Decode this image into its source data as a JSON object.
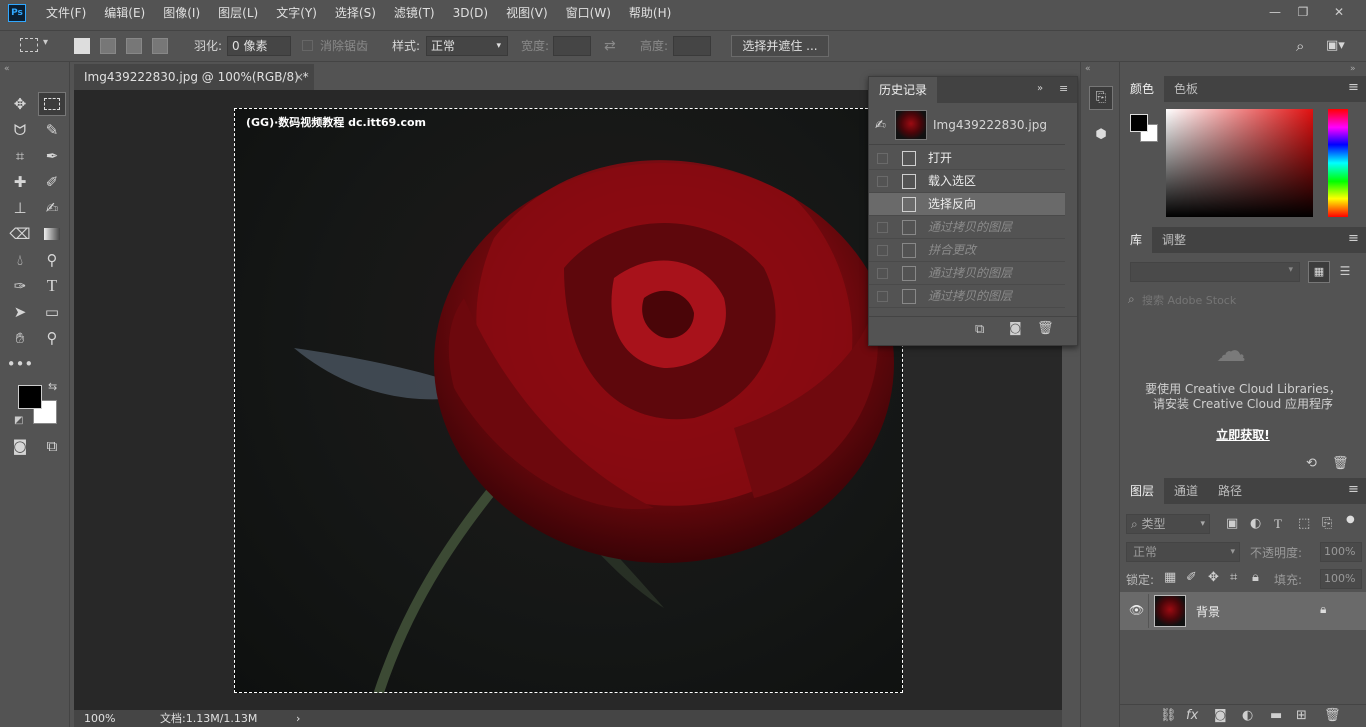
{
  "app": {
    "logo": "Ps"
  },
  "menu": [
    "文件(F)",
    "编辑(E)",
    "图像(I)",
    "图层(L)",
    "文字(Y)",
    "选择(S)",
    "滤镜(T)",
    "3D(D)",
    "视图(V)",
    "窗口(W)",
    "帮助(H)"
  ],
  "window_controls": {
    "minimize": "—",
    "restore": "❐",
    "close": "✕"
  },
  "options": {
    "feather_label": "羽化:",
    "feather_value": "0 像素",
    "antialias_label": "消除锯齿",
    "style_label": "样式:",
    "style_value": "正常",
    "width_label": "宽度:",
    "height_label": "高度:",
    "select_mask_button": "选择并遮住 ..."
  },
  "document": {
    "tab_title": "Img439222830.jpg @ 100%(RGB/8) *",
    "tab_close": "×",
    "watermark": "(GG)·数码视频教程  dc.itt69.com"
  },
  "status": {
    "zoom": "100%",
    "doc_info": "文档:1.13M/1.13M",
    "arrow": "›"
  },
  "history": {
    "title": "历史记录",
    "snapshot_name": "Img439222830.jpg",
    "items": [
      {
        "label": "打开",
        "state": "normal"
      },
      {
        "label": "载入选区",
        "state": "normal"
      },
      {
        "label": "选择反向",
        "state": "selected"
      },
      {
        "label": "通过拷贝的图层",
        "state": "undone"
      },
      {
        "label": "拼合更改",
        "state": "undone"
      },
      {
        "label": "通过拷贝的图层",
        "state": "undone"
      },
      {
        "label": "通过拷贝的图层",
        "state": "undone"
      }
    ]
  },
  "color_panel": {
    "tabs": [
      "颜色",
      "色板"
    ]
  },
  "library_panel": {
    "tabs": [
      "库",
      "调整"
    ],
    "search_placeholder": "搜索 Adobe Stock",
    "message_line1": "要使用 Creative Cloud Libraries，",
    "message_line2": "请安装 Creative Cloud 应用程序",
    "link": "立即获取!"
  },
  "layers_panel": {
    "tabs": [
      "图层",
      "通道",
      "路径"
    ],
    "filter_label": "类型",
    "blend_mode": "正常",
    "opacity_label": "不透明度:",
    "opacity_value": "100%",
    "lock_label": "锁定:",
    "fill_label": "填充:",
    "fill_value": "100%",
    "layers": [
      {
        "name": "背景",
        "visible": true,
        "locked": true
      }
    ]
  },
  "colors": {
    "accent": "#31a8ff",
    "rose": "#8f0a10",
    "panel": "#535353",
    "canvas_bg": "#282828"
  }
}
